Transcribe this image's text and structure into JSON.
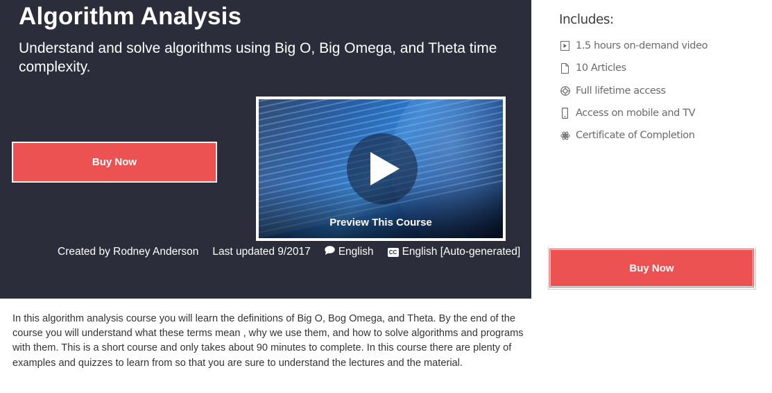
{
  "course": {
    "title": "Algorithm Analysis",
    "subtitle": "Understand and solve algorithms using Big O, Big Omega, and Theta time complexity."
  },
  "hero": {
    "buy_label": "Buy Now",
    "preview_label": "Preview This Course"
  },
  "meta": {
    "created_by": "Created by Rodney Anderson",
    "last_updated": "Last updated 9/2017",
    "language": "English",
    "captions": "English [Auto-generated]"
  },
  "description": "In this algorithm analysis course you will learn the definitions of Big O, Bog Omega, and Theta. By the end of the course you will understand what these terms mean , why we use them, and how to solve algorithms and programs with them. This is a short course and only takes about 90 minutes to complete. In this course there are plenty of examples and quizzes to learn from so that you are sure to understand the lectures and the material.",
  "sidebar": {
    "includes_title": "Includes:",
    "items": [
      {
        "icon": "video-icon",
        "label": "1.5 hours on-demand video"
      },
      {
        "icon": "article-icon",
        "label": "10 Articles"
      },
      {
        "icon": "lifetime-icon",
        "label": "Full lifetime access"
      },
      {
        "icon": "mobile-icon",
        "label": "Access on mobile and TV"
      },
      {
        "icon": "certificate-icon",
        "label": "Certificate of Completion"
      }
    ],
    "buy_label": "Buy Now"
  },
  "colors": {
    "hero_bg": "#2b2e3a",
    "buy_button": "#ec5252",
    "text_light": "#ffffff",
    "text_muted": "#6a6a6a"
  }
}
